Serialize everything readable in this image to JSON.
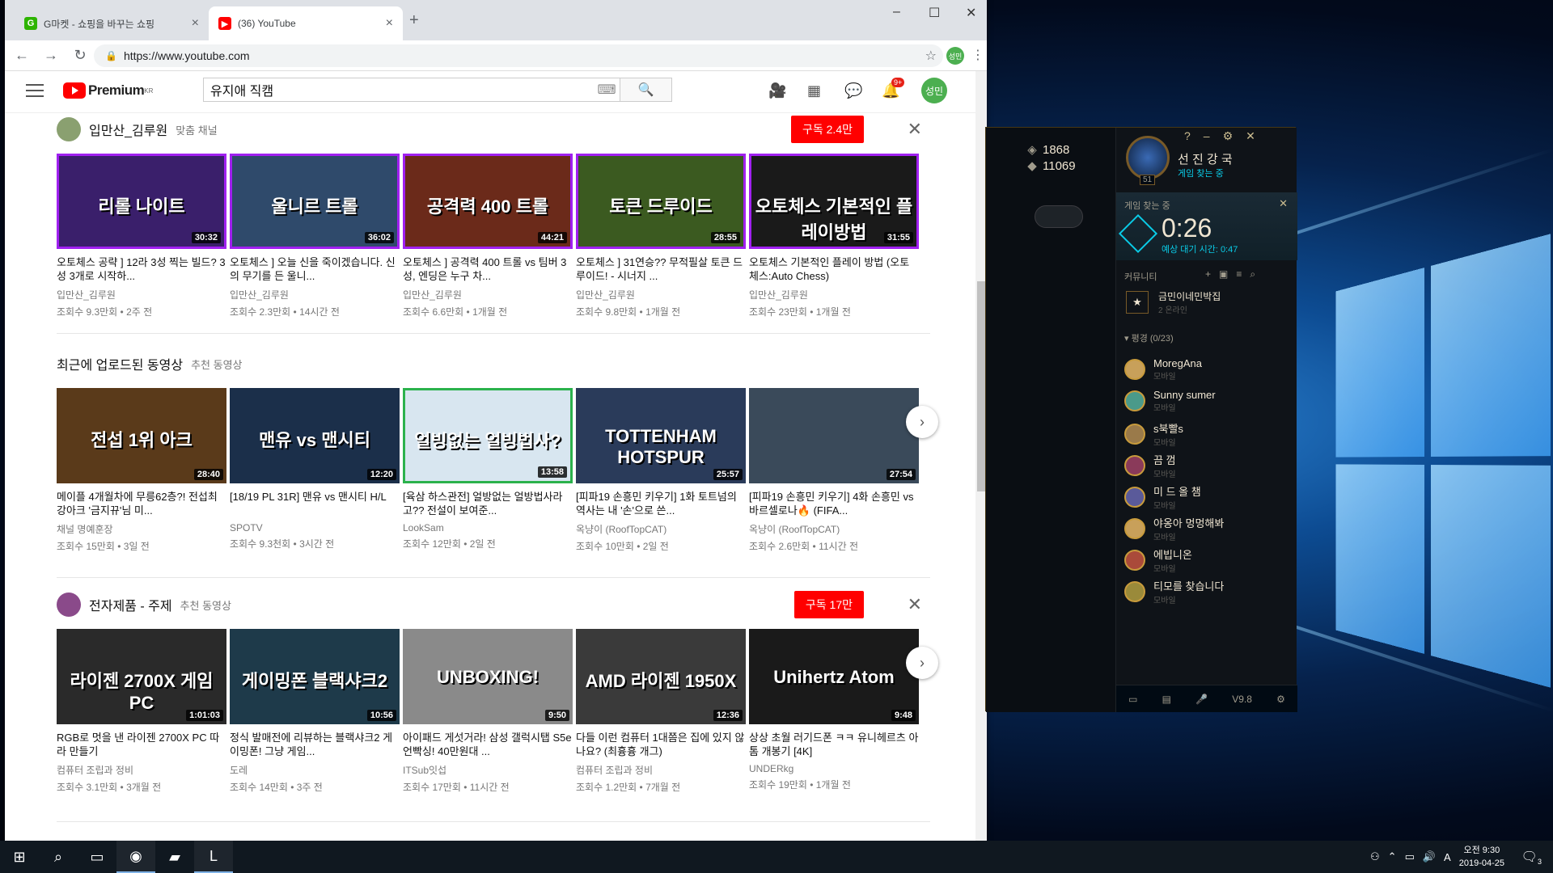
{
  "browser": {
    "tabs": [
      {
        "title": "G마켓 - 쇼핑을 바꾸는 쇼핑",
        "fav": "G",
        "favcolor": "#2db400"
      },
      {
        "title": "(36) YouTube",
        "fav": "▶",
        "favcolor": "#ff0000"
      }
    ],
    "url": "https://www.youtube.com",
    "profile": "성민"
  },
  "youtube": {
    "logo_word": "Premium",
    "logo_region": "KR",
    "search_value": "유지애 직캠",
    "notif_badge": "9+",
    "avatar": "성민"
  },
  "sections": [
    {
      "channel": "입만산_김루원",
      "subtitle": "맞춤 채널",
      "subscribe": "구독 2.4만",
      "videos": [
        {
          "thumb": "리롤 나이트",
          "dur": "30:32",
          "title": "오토체스 공략 ] 12라 3성 찍는 빌드? 3성 3개로 시작하...",
          "channel": "입만산_김루원",
          "meta": "조회수 9.3만회 • 2주 전",
          "bg": "#3a1f6b",
          "border": "#a020f0"
        },
        {
          "thumb": "울니르 트롤",
          "dur": "36:02",
          "title": "오토체스 ] 오늘 신을 죽이겠습니다. 신의 무기를 든 울니...",
          "channel": "입만산_김루원",
          "meta": "조회수 2.3만회 • 14시간 전",
          "bg": "#2f4a6b",
          "border": "#a020f0"
        },
        {
          "thumb": "공격력 400 트롤",
          "dur": "44:21",
          "title": "오토체스 ] 공격력 400 트롤 vs 팀버 3성, 엔딩은 누구 차...",
          "channel": "입만산_김루원",
          "meta": "조회수 6.6만회 • 1개월 전",
          "bg": "#6b2a1a",
          "border": "#a020f0"
        },
        {
          "thumb": "토큰 드루이드",
          "dur": "28:55",
          "title": "오토체스 ] 31연승?? 무적필살 토큰 드루이드! - 시너지 ...",
          "channel": "입만산_김루원",
          "meta": "조회수 9.8만회 • 1개월 전",
          "bg": "#3b5a20",
          "border": "#a020f0"
        },
        {
          "thumb": "오토체스 기본적인 플레이방법",
          "dur": "31:55",
          "title": "오토체스 기본적인 플레이 방법 (오토체스:Auto Chess)",
          "channel": "입만산_김루원",
          "meta": "조회수 23만회 • 1개월 전",
          "bg": "#1a1a1a",
          "border": "#a020f0"
        }
      ]
    },
    {
      "channel": "최근에 업로드된 동영상",
      "subtitle": "추천 동영상",
      "videos": [
        {
          "thumb": "전섭 1위 아크",
          "dur": "28:40",
          "title": "메이플 4개월차에 무릉62층?! 전섭최강아크 '금지뀨'님 미...",
          "channel": "채널 명예훈장",
          "meta": "조회수 15만회 • 3일 전",
          "bg": "#5a3a1a",
          "border": "none"
        },
        {
          "thumb": "맨유 vs 맨시티",
          "dur": "12:20",
          "title": "[18/19 PL 31R] 맨유 vs 맨시티 H/L",
          "channel": "SPOTV",
          "meta": "조회수 9.3천회 • 3시간 전",
          "bg": "#1b2f4a",
          "border": "none"
        },
        {
          "thumb": "얼빙없는 얼빙법사?",
          "dur": "13:58",
          "title": "[육삼 하스관전] 얼방없는 얼방법사라고?? 전설이 보여준...",
          "channel": "LookSam",
          "meta": "조회수 12만회 • 2일 전",
          "bg": "#d8e6f0",
          "border": "#2bb24c"
        },
        {
          "thumb": "TOTTENHAM HOTSPUR",
          "dur": "25:57",
          "title": "[피파19 손흥민 키우기] 1화 토트넘의 역사는 내 '손'으로 쓴...",
          "channel": "옥냥이 (RoofTopCAT)",
          "meta": "조회수 10만회 • 2일 전",
          "bg": "#2a3b5a",
          "border": "none"
        },
        {
          "thumb": "",
          "dur": "27:54",
          "title": "[피파19 손흥민 키우기] 4화 손흥민 vs 바르셀로나🔥 (FIFA...",
          "channel": "옥냥이 (RoofTopCAT)",
          "meta": "조회수 2.6만회 • 11시간 전",
          "bg": "#3a4a5a",
          "border": "none"
        }
      ]
    },
    {
      "channel": "전자제품 - 주제",
      "subtitle": "추천 동영상",
      "subscribe": "구독 17만",
      "videos": [
        {
          "thumb": "라이젠 2700X 게임 PC",
          "dur": "1:01:03",
          "title": "RGB로 멋을 낸 라이젠 2700X PC 따라 만들기",
          "channel": "컴퓨터 조립과 정비",
          "meta": "조회수 3.1만회 • 3개월 전",
          "bg": "#2a2a2a",
          "border": "none"
        },
        {
          "thumb": "게이밍폰 블랙샤크2",
          "dur": "10:56",
          "title": "정식 발매전에 리뷰하는 블랙샤크2 게이밍폰! 그냥 게임...",
          "channel": "도레",
          "meta": "조회수 14만회 • 3주 전",
          "bg": "#1e3a4a",
          "border": "none"
        },
        {
          "thumb": "UNBOXING!",
          "dur": "9:50",
          "title": "아이패드 게섯거라! 삼성 갤럭시탭 S5e 언빡싱! 40만원대 ...",
          "channel": "ITSub잇섭",
          "meta": "조회수 17만회 • 11시간 전",
          "bg": "#8a8a8a",
          "border": "none"
        },
        {
          "thumb": "AMD 라이젠 1950X",
          "dur": "12:36",
          "title": "다들 이런 컴퓨터 1대쯤은 집에 있지 않나요? (최흉흉 개그)",
          "channel": "컴퓨터 조립과 정비",
          "meta": "조회수 1.2만회 • 7개월 전",
          "bg": "#3a3a3a",
          "border": "none"
        },
        {
          "thumb": "Unihertz Atom",
          "dur": "9:48",
          "title": "상상 초월 러기드폰 ㅋㅋ 유니헤르츠 아톰 개봉기 [4K]",
          "channel": "UNDERkg",
          "meta": "조회수 19만회 • 1개월 전",
          "bg": "#1a1a1a",
          "border": "none"
        }
      ]
    }
  ],
  "lol": {
    "rp": "1868",
    "be": "11069",
    "summoner": "선 진 강 국",
    "status": "게임 찾는 중",
    "level": "51",
    "queue_label": "게임 찾는 중",
    "timer": "0:26",
    "estimate": "예상 대기 시간: 0:47",
    "community": "커뮤니티",
    "club_name": "금민이네민박집",
    "club_status": "2 온라인",
    "group": "평경 (0/23)",
    "friends": [
      {
        "name": "MoregAna",
        "status": "모바일",
        "color": "#c8a05a"
      },
      {
        "name": "Sunny sumer",
        "status": "모바일",
        "color": "#4a9a8a"
      },
      {
        "name": "s북빨s",
        "status": "모바일",
        "color": "#9a7a4a"
      },
      {
        "name": "끔 껌",
        "status": "모바일",
        "color": "#8a3a5a"
      },
      {
        "name": "미 드 올 챔",
        "status": "모바일",
        "color": "#5a5a9a"
      },
      {
        "name": "야옹아 멍멍해봐",
        "status": "모바일",
        "color": "#c8a05a"
      },
      {
        "name": "에빕니온",
        "status": "모바일",
        "color": "#aa4a3a"
      },
      {
        "name": "티모를 찾습니다",
        "status": "모바일",
        "color": "#9a8a3a"
      }
    ],
    "version": "V9.8"
  },
  "taskbar": {
    "time": "오전 9:30",
    "date": "2019-04-25",
    "ime": "A",
    "notif_count": "3"
  }
}
